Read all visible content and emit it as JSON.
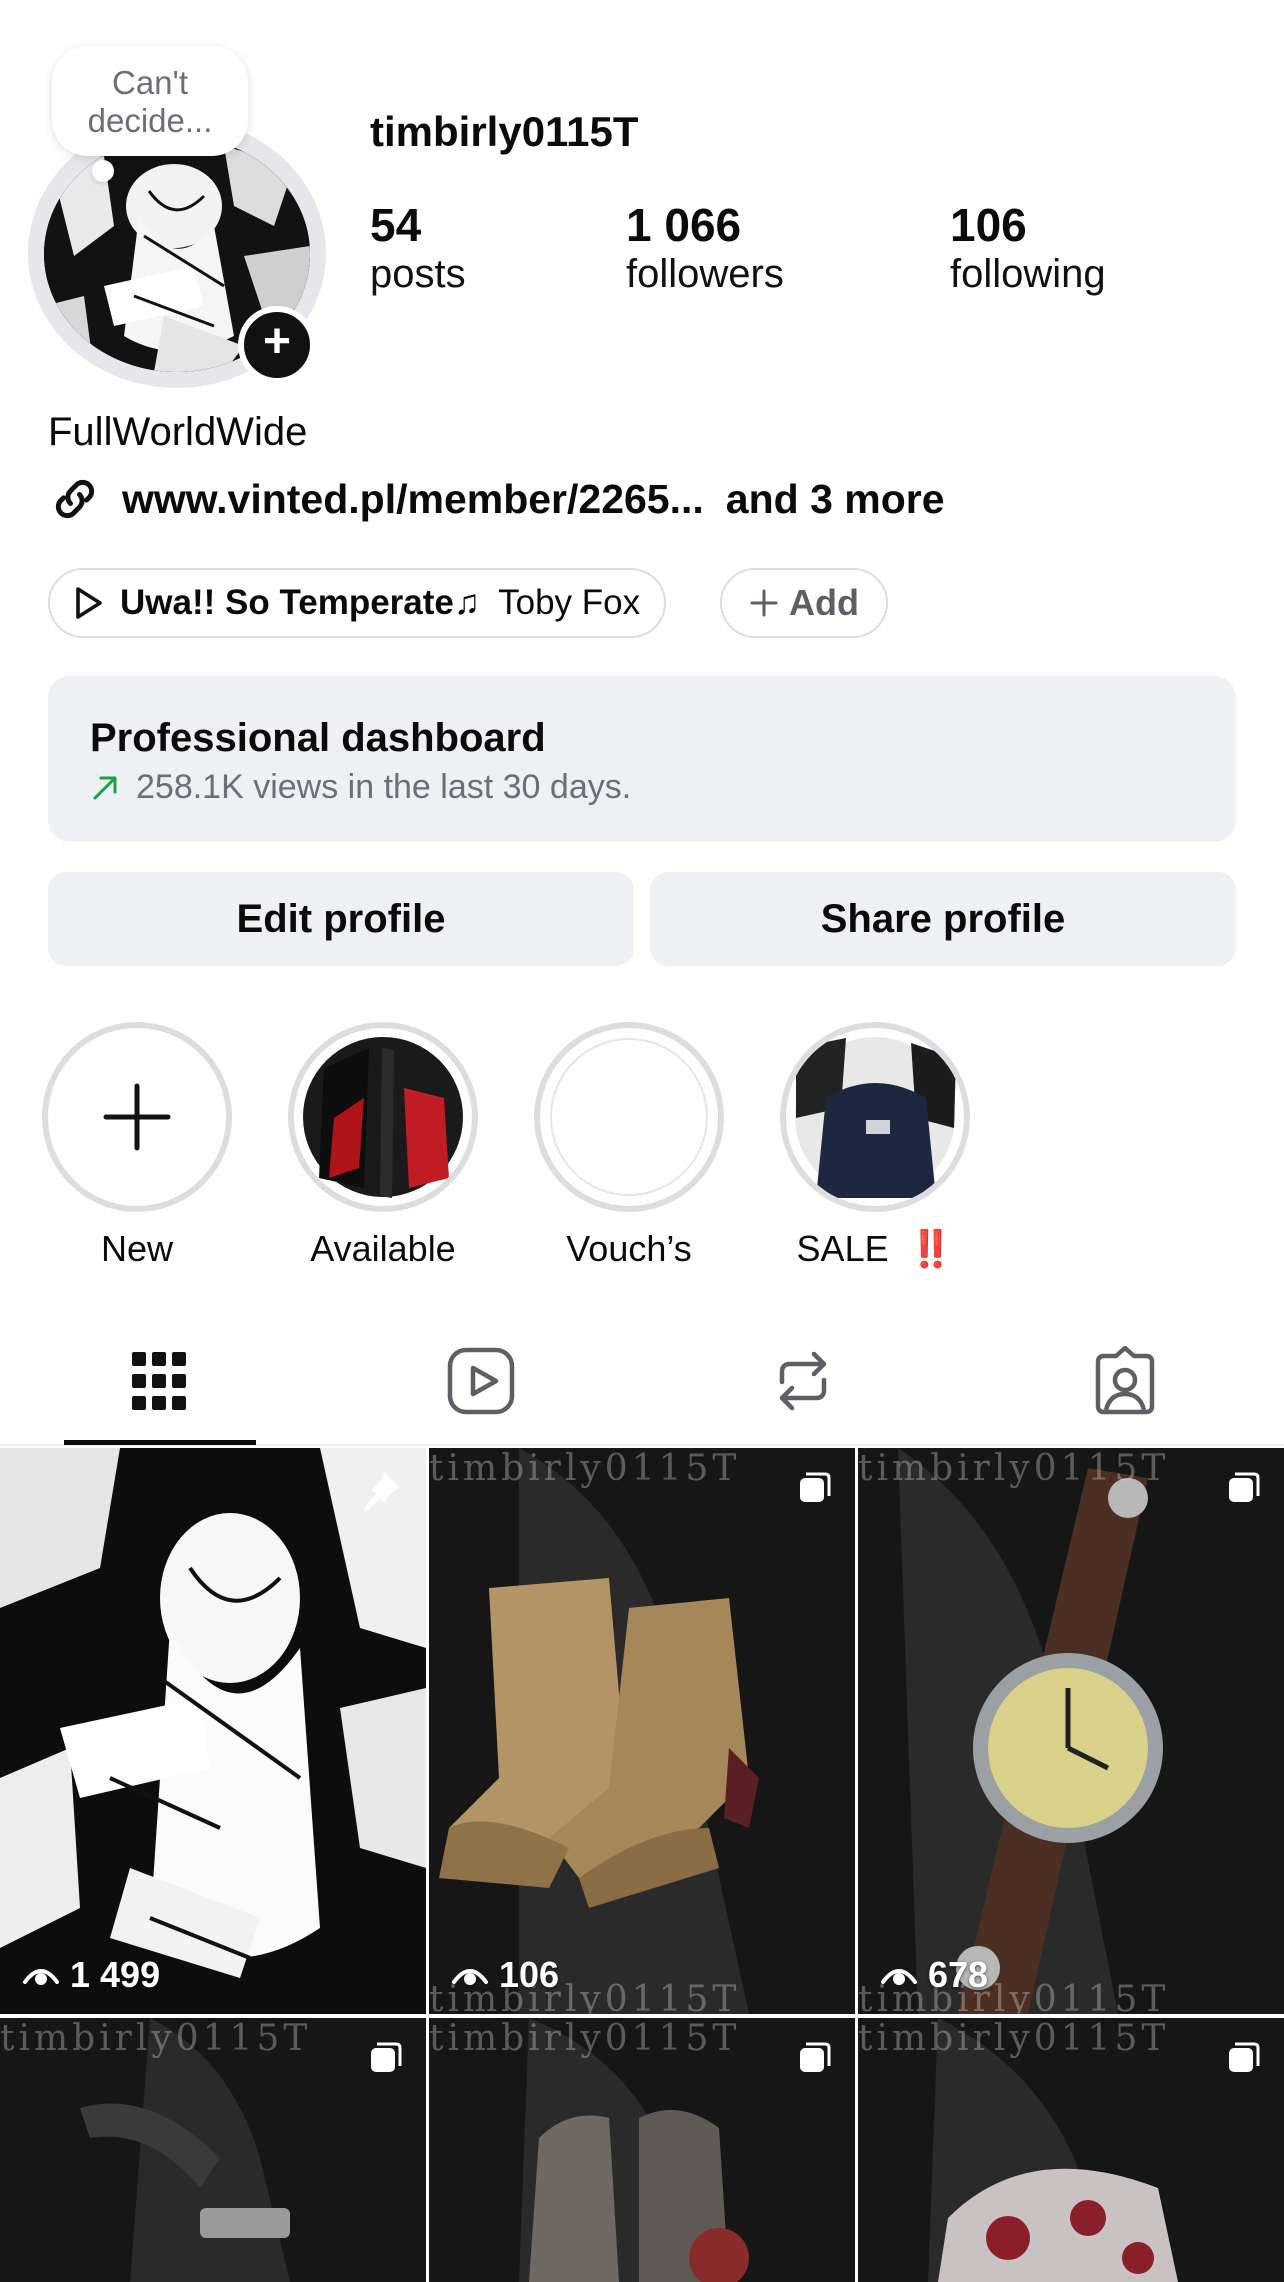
{
  "profile": {
    "note": "Can't decide...",
    "username": "timbirly0115T",
    "display_name": "FullWorldWide",
    "link_text": "www.vinted.pl/member/2265...",
    "link_more": "and 3 more"
  },
  "stats": {
    "posts_count": "54",
    "posts_label": "posts",
    "followers_count": "1 066",
    "followers_label": "followers",
    "following_count": "106",
    "following_label": "following"
  },
  "music": {
    "title": "Uwa!! So Temperate♫",
    "artist": "Toby Fox",
    "add_label": "Add"
  },
  "dashboard": {
    "title": "Professional dashboard",
    "subtitle": "258.1K views in the last 30 days."
  },
  "buttons": {
    "edit_label": "Edit profile",
    "share_label": "Share profile"
  },
  "highlights": [
    {
      "label": "New"
    },
    {
      "label": "Available"
    },
    {
      "label": "Vouch’s"
    },
    {
      "label": "SALE",
      "badge": "‼️"
    }
  ],
  "tabs": [
    {
      "icon": "grid-icon",
      "active": true
    },
    {
      "icon": "reels-icon",
      "active": false
    },
    {
      "icon": "reposts-icon",
      "active": false
    },
    {
      "icon": "tagged-icon",
      "active": false
    }
  ],
  "grid": {
    "watermark": "timbirly0115T",
    "posts": [
      {
        "views": "1 499",
        "pinned": true
      },
      {
        "views": "106",
        "multi": true
      },
      {
        "views": "678",
        "multi": true
      },
      {
        "multi": true
      },
      {
        "multi": true
      },
      {
        "multi": true
      }
    ]
  },
  "colors": {
    "accent_green": "#1aa34a",
    "surface": "#eff0f3",
    "text": "#0b0b0b",
    "muted": "#6d6f76",
    "sale_red": "#e0201c"
  }
}
